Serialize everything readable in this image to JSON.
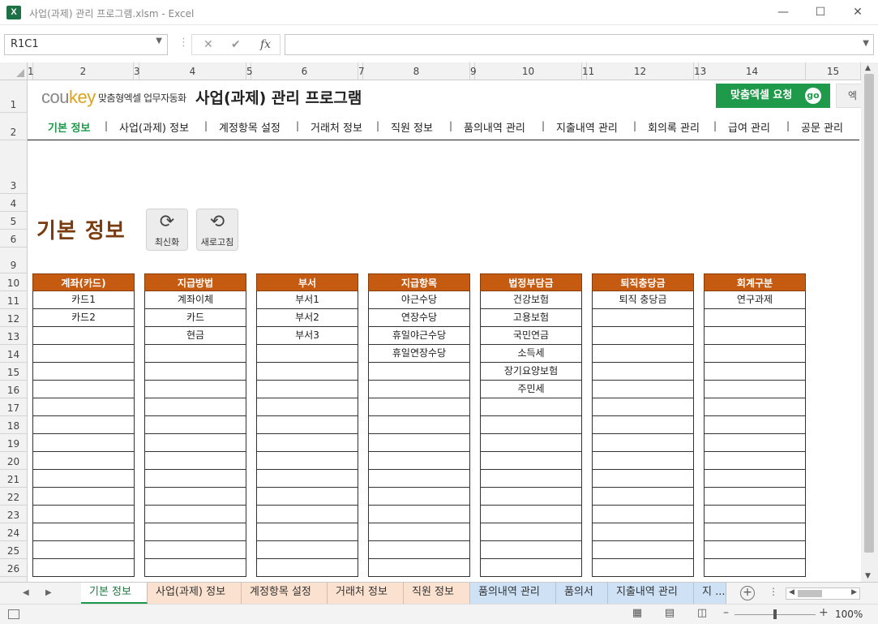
{
  "window": {
    "title": "사업(과제) 관리 프로그램.xlsm - Excel",
    "app_icon": "X"
  },
  "formula": {
    "name_box": "R1C1",
    "value": ""
  },
  "columns": [
    "1",
    "2",
    "3",
    "4",
    "5",
    "6",
    "7",
    "8",
    "9",
    "10",
    "11",
    "12",
    "13",
    "14",
    "15"
  ],
  "rows": [
    "1",
    "2",
    "3",
    "4",
    "5",
    "6",
    "9",
    "10",
    "11",
    "12",
    "13",
    "14",
    "15",
    "16",
    "17",
    "18",
    "19",
    "20",
    "21",
    "22",
    "23",
    "24",
    "25",
    "26"
  ],
  "header": {
    "logo_co": "cou",
    "logo_key": "key",
    "logo_sub": "맞춤형엑셀 업무자동화",
    "title": "사업(과제) 관리 프로그램",
    "custom_btn": "맞춤엑셀 요청",
    "go": "go",
    "extra_btn": "엑"
  },
  "nav": [
    {
      "label": "기본 정보",
      "active": true
    },
    {
      "label": "사업(과제) 정보"
    },
    {
      "label": "계정항목 설정"
    },
    {
      "label": "거래처 정보"
    },
    {
      "label": "직원 정보"
    },
    {
      "label": "품의내역 관리"
    },
    {
      "label": "지출내역 관리"
    },
    {
      "label": "회의록 관리"
    },
    {
      "label": "급여 관리"
    },
    {
      "label": "공문 관리"
    }
  ],
  "section_title": "기본 정보",
  "buttons": {
    "refresh": "최신화",
    "reload": "새로고침"
  },
  "tables": [
    {
      "header": "계좌(카드)",
      "items": [
        "카드1",
        "카드2"
      ]
    },
    {
      "header": "지급방법",
      "items": [
        "계좌이체",
        "카드",
        "현금"
      ]
    },
    {
      "header": "부서",
      "items": [
        "부서1",
        "부서2",
        "부서3"
      ]
    },
    {
      "header": "지급항목",
      "items": [
        "야근수당",
        "연장수당",
        "휴일야근수당",
        "휴일연장수당"
      ]
    },
    {
      "header": "법정부담금",
      "items": [
        "건강보험",
        "고용보험",
        "국민연금",
        "소득세",
        "장기요양보험",
        "주민세"
      ]
    },
    {
      "header": "퇴직충당금",
      "items": [
        "퇴직 충당금"
      ]
    },
    {
      "header": "회계구분",
      "items": [
        "연구과제"
      ]
    }
  ],
  "sheet_tabs": [
    {
      "label": "기본 정보",
      "style": "active"
    },
    {
      "label": "사업(과제) 정보",
      "style": "orange"
    },
    {
      "label": "계정항목 설정",
      "style": "orange"
    },
    {
      "label": "거래처 정보",
      "style": "orange"
    },
    {
      "label": "직원 정보",
      "style": "orange"
    },
    {
      "label": "품의내역 관리",
      "style": "blue"
    },
    {
      "label": "품의서",
      "style": "blue"
    },
    {
      "label": "지출내역 관리",
      "style": "blue"
    },
    {
      "label": "지 ...",
      "style": "blue"
    }
  ],
  "status": {
    "zoom": "100%"
  },
  "colors": {
    "accent_green": "#1f9a4a",
    "table_header": "#c55a11",
    "section_title": "#7a3c0f"
  }
}
